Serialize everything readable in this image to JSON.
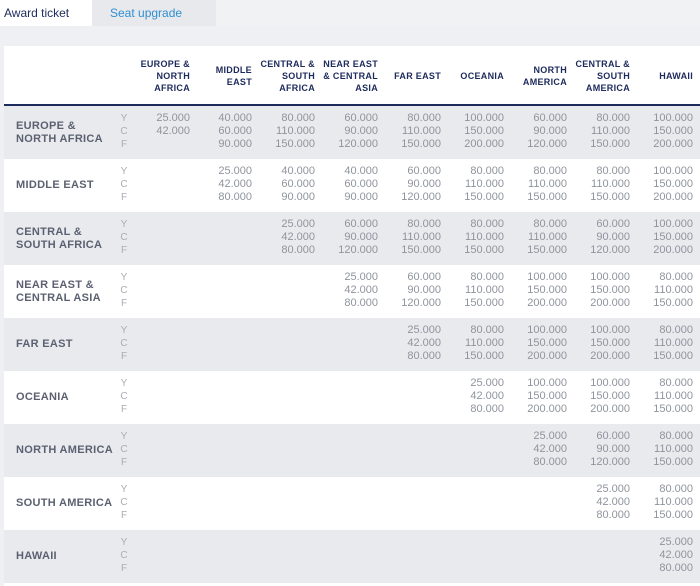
{
  "tabs": [
    {
      "label": "Award ticket",
      "active": true
    },
    {
      "label": "Seat upgrade",
      "active": false
    }
  ],
  "columns": [
    [
      "EUROPE &",
      "NORTH",
      "AFRICA"
    ],
    [
      "MIDDLE",
      "EAST"
    ],
    [
      "CENTRAL &",
      "SOUTH",
      "AFRICA"
    ],
    [
      "NEAR EAST",
      "& CENTRAL",
      "ASIA"
    ],
    [
      "FAR EAST"
    ],
    [
      "OCEANIA"
    ],
    [
      "NORTH",
      "AMERICA"
    ],
    [
      "CENTRAL &",
      "SOUTH",
      "AMERICA"
    ],
    [
      "HAWAII"
    ]
  ],
  "class_codes": [
    "Y",
    "C",
    "F"
  ],
  "rows": [
    {
      "label": [
        "EUROPE &",
        "NORTH AFRICA"
      ],
      "shaded": true,
      "cells": [
        [
          "25.000",
          "42.000"
        ],
        [
          "40.000",
          "60.000",
          "90.000"
        ],
        [
          "80.000",
          "110.000",
          "150.000"
        ],
        [
          "60.000",
          "90.000",
          "120.000"
        ],
        [
          "80.000",
          "110.000",
          "150.000"
        ],
        [
          "100.000",
          "150.000",
          "200.000"
        ],
        [
          "60.000",
          "90.000",
          "120.000"
        ],
        [
          "80.000",
          "110.000",
          "150.000"
        ],
        [
          "100.000",
          "150.000",
          "200.000"
        ]
      ]
    },
    {
      "label": [
        "MIDDLE EAST"
      ],
      "shaded": false,
      "cells": [
        null,
        [
          "25.000",
          "42.000",
          "80.000"
        ],
        [
          "40.000",
          "60.000",
          "90.000"
        ],
        [
          "40.000",
          "60.000",
          "90.000"
        ],
        [
          "60.000",
          "90.000",
          "120.000"
        ],
        [
          "80.000",
          "110.000",
          "150.000"
        ],
        [
          "80.000",
          "110.000",
          "150.000"
        ],
        [
          "80.000",
          "110.000",
          "150.000"
        ],
        [
          "100.000",
          "150.000",
          "200.000"
        ]
      ]
    },
    {
      "label": [
        "CENTRAL &",
        "SOUTH AFRICA"
      ],
      "shaded": true,
      "cells": [
        null,
        null,
        [
          "25.000",
          "42.000",
          "80.000"
        ],
        [
          "60.000",
          "90.000",
          "120.000"
        ],
        [
          "80.000",
          "110.000",
          "150.000"
        ],
        [
          "80.000",
          "110.000",
          "150.000"
        ],
        [
          "80.000",
          "110.000",
          "150.000"
        ],
        [
          "60.000",
          "90.000",
          "120.000"
        ],
        [
          "100.000",
          "150.000",
          "200.000"
        ]
      ]
    },
    {
      "label": [
        "NEAR EAST &",
        "CENTRAL ASIA"
      ],
      "shaded": false,
      "cells": [
        null,
        null,
        null,
        [
          "25.000",
          "42.000",
          "80.000"
        ],
        [
          "60.000",
          "90.000",
          "120.000"
        ],
        [
          "80.000",
          "110.000",
          "150.000"
        ],
        [
          "100.000",
          "150.000",
          "200.000"
        ],
        [
          "100.000",
          "150.000",
          "200.000"
        ],
        [
          "80.000",
          "110.000",
          "150.000"
        ]
      ]
    },
    {
      "label": [
        "FAR EAST"
      ],
      "shaded": true,
      "cells": [
        null,
        null,
        null,
        null,
        [
          "25.000",
          "42.000",
          "80.000"
        ],
        [
          "80.000",
          "110.000",
          "150.000"
        ],
        [
          "100.000",
          "150.000",
          "200.000"
        ],
        [
          "100.000",
          "150.000",
          "200.000"
        ],
        [
          "80.000",
          "110.000",
          "150.000"
        ]
      ]
    },
    {
      "label": [
        "OCEANIA"
      ],
      "shaded": false,
      "cells": [
        null,
        null,
        null,
        null,
        null,
        [
          "25.000",
          "42.000",
          "80.000"
        ],
        [
          "100.000",
          "150.000",
          "200.000"
        ],
        [
          "100.000",
          "150.000",
          "200.000"
        ],
        [
          "80.000",
          "110.000",
          "150.000"
        ]
      ]
    },
    {
      "label": [
        "NORTH AMERICA"
      ],
      "shaded": true,
      "cells": [
        null,
        null,
        null,
        null,
        null,
        null,
        [
          "25.000",
          "42.000",
          "80.000"
        ],
        [
          "60.000",
          "90.000",
          "120.000"
        ],
        [
          "80.000",
          "110.000",
          "150.000"
        ]
      ]
    },
    {
      "label": [
        "SOUTH AMERICA"
      ],
      "shaded": false,
      "cells": [
        null,
        null,
        null,
        null,
        null,
        null,
        null,
        [
          "25.000",
          "42.000",
          "80.000"
        ],
        [
          "80.000",
          "110.000",
          "150.000"
        ]
      ]
    },
    {
      "label": [
        "HAWAII"
      ],
      "shaded": true,
      "cells": [
        null,
        null,
        null,
        null,
        null,
        null,
        null,
        null,
        [
          "25.000",
          "42.000",
          "80.000"
        ]
      ]
    }
  ]
}
